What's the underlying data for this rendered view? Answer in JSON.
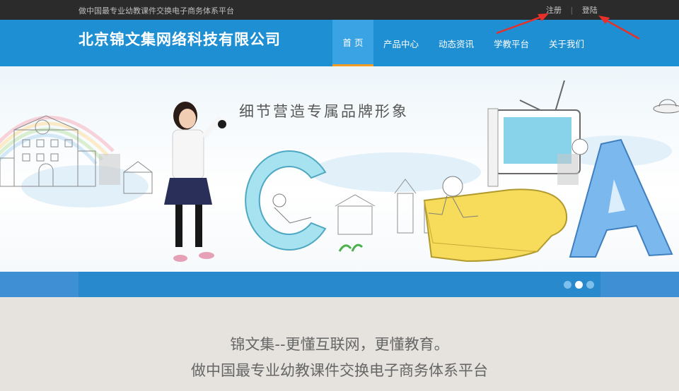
{
  "topbar": {
    "tagline": "做中国最专业幼教课件交换电子商务体系平台",
    "register_label": "注册",
    "separator": "|",
    "login_label": "登陆"
  },
  "header": {
    "brand": "北京锦文集网络科技有限公司",
    "nav": [
      {
        "label": "首 页",
        "active": true
      },
      {
        "label": "产品中心"
      },
      {
        "label": "动态资讯"
      },
      {
        "label": "学教平台"
      },
      {
        "label": "关于我们"
      }
    ]
  },
  "banner": {
    "headline": "细节营造专属品牌形象",
    "letters": [
      "C",
      "B",
      "A"
    ],
    "slides_total": 3,
    "active_slide": 2
  },
  "slogan": {
    "line1": "锦文集--更懂互联网，更懂教育。",
    "line2": "做中国最专业幼教课件交换电子商务体系平台"
  },
  "colors": {
    "header_blue": "#1f8fd3",
    "active_tab": "#3aa3e3",
    "active_underline": "#f19a24",
    "annotation_arrow": "#e8302a"
  }
}
